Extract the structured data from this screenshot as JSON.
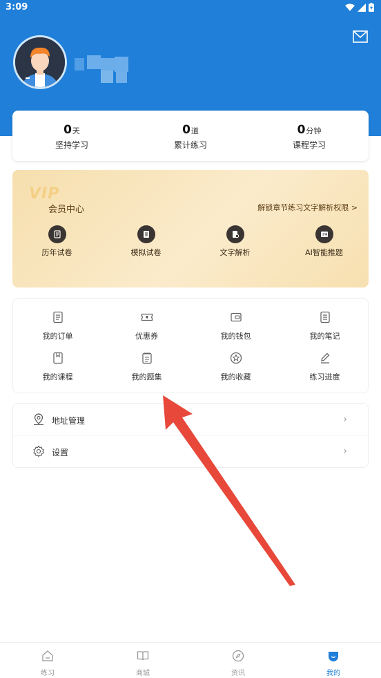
{
  "status_bar": {
    "time": "3:09"
  },
  "header": {
    "mail_icon": "mail-icon",
    "avatar": "avatar"
  },
  "stats": [
    {
      "value": "0",
      "unit": "天",
      "label": "坚持学习"
    },
    {
      "value": "0",
      "unit": "道",
      "label": "累计练习"
    },
    {
      "value": "0",
      "unit": "分钟",
      "label": "课程学习"
    }
  ],
  "vip": {
    "logo": "VIP",
    "title": "会员中心",
    "subtitle": "解锁章节练习文字解析权限 >",
    "items": [
      {
        "label": "历年试卷",
        "icon": "exam-paper-icon"
      },
      {
        "label": "模拟试卷",
        "icon": "mock-exam-icon"
      },
      {
        "label": "文字解析",
        "icon": "analysis-icon"
      },
      {
        "label": "AI智能推题",
        "icon": "ai-icon"
      }
    ]
  },
  "grid": {
    "row1": [
      {
        "label": "我的订单",
        "icon": "order-icon"
      },
      {
        "label": "优惠券",
        "icon": "coupon-icon"
      },
      {
        "label": "我的钱包",
        "icon": "wallet-icon"
      },
      {
        "label": "我的笔记",
        "icon": "notes-icon"
      }
    ],
    "row2": [
      {
        "label": "我的课程",
        "icon": "course-icon"
      },
      {
        "label": "我的题集",
        "icon": "question-set-icon"
      },
      {
        "label": "我的收藏",
        "icon": "favorite-icon"
      },
      {
        "label": "练习进度",
        "icon": "edit-icon"
      }
    ]
  },
  "menu": [
    {
      "label": "地址管理",
      "icon": "location-icon"
    },
    {
      "label": "设置",
      "icon": "gear-icon"
    }
  ],
  "nav": [
    {
      "label": "练习",
      "icon": "home-icon"
    },
    {
      "label": "商城",
      "icon": "shop-icon"
    },
    {
      "label": "资讯",
      "icon": "compass-icon"
    },
    {
      "label": "我的",
      "icon": "profile-icon",
      "active": true
    }
  ],
  "colors": {
    "primary": "#1f7fd9",
    "vip_text": "#5a3b12",
    "arrow": "#e8483a"
  }
}
